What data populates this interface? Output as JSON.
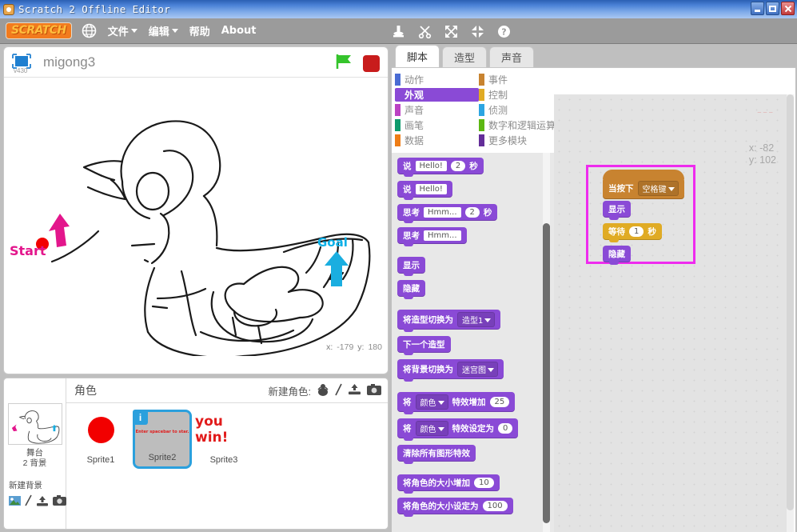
{
  "window": {
    "title": "Scratch 2 Offline Editor",
    "app_icon": "scratch-cat-icon",
    "buttons": {
      "minimize": "minimize-icon",
      "maximize": "maximize-icon",
      "close": "close-icon"
    }
  },
  "menubar": {
    "logo": "SCRATCH",
    "globe_icon": "globe-icon",
    "items": [
      {
        "label": "文件",
        "has_caret": true
      },
      {
        "label": "编辑",
        "has_caret": true
      },
      {
        "label": "帮助",
        "has_caret": false
      },
      {
        "label": "About",
        "has_caret": false
      }
    ],
    "tools": [
      {
        "name": "duplicate-icon"
      },
      {
        "name": "scissors-icon"
      },
      {
        "name": "grow-icon"
      },
      {
        "name": "shrink-icon"
      },
      {
        "name": "help-icon"
      }
    ]
  },
  "stage": {
    "version_tag": "v430",
    "project_name": "migong3",
    "presentation_icon": "presentation-mode-icon",
    "green_flag": "green-flag-icon",
    "stop_button": "stop-icon",
    "labels": {
      "start": "Start",
      "goal": "Goal"
    },
    "mouse_coords": {
      "x_label": "x:",
      "x": "-179",
      "y_label": "y:",
      "y": "180"
    }
  },
  "sprite_pane": {
    "stage_section": {
      "thumb_name": "stage-thumbnail",
      "title": "舞台",
      "subtitle": "2 背景",
      "new_backdrop_label": "新建背景",
      "new_backdrop_icons": [
        "library-icon",
        "paint-icon",
        "upload-icon",
        "camera-icon"
      ]
    },
    "header_title": "角色",
    "new_sprite_label": "新建角色:",
    "new_sprite_icons": [
      "library-icon",
      "paint-icon",
      "upload-icon",
      "camera-icon"
    ],
    "sprites": [
      {
        "name": "Sprite1",
        "selected": false,
        "kind": "red-dot"
      },
      {
        "name": "Sprite2",
        "selected": true,
        "kind": "text",
        "thumb_text": "Enter spacebar to star."
      },
      {
        "name": "Sprite3",
        "selected": false,
        "kind": "youwin",
        "thumb_text": "you win!"
      }
    ]
  },
  "editor": {
    "tabs": [
      {
        "label": "脚本",
        "active": true
      },
      {
        "label": "造型",
        "active": false
      },
      {
        "label": "声音",
        "active": false
      }
    ],
    "categories_left": [
      {
        "label": "动作",
        "color": "#4a6cd4",
        "active": false
      },
      {
        "label": "外观",
        "color": "#8a4ad6",
        "active": true
      },
      {
        "label": "声音",
        "color": "#bb42c3",
        "active": false
      },
      {
        "label": "画笔",
        "color": "#0e9a6c",
        "active": false
      },
      {
        "label": "数据",
        "color": "#ee7d16",
        "active": false
      }
    ],
    "categories_right": [
      {
        "label": "事件",
        "color": "#c88330",
        "active": false
      },
      {
        "label": "控制",
        "color": "#e0ab24",
        "active": false
      },
      {
        "label": "侦测",
        "color": "#2ca5e2",
        "active": false
      },
      {
        "label": "数字和逻辑运算",
        "color": "#5cb712",
        "active": false
      },
      {
        "label": "更多模块",
        "color": "#632d99",
        "active": false
      }
    ],
    "palette_blocks": [
      {
        "id": "say-for-secs",
        "parts": [
          {
            "t": "label",
            "v": "说"
          },
          {
            "t": "text",
            "v": "Hello!"
          },
          {
            "t": "num",
            "v": "2"
          },
          {
            "t": "label",
            "v": "秒"
          }
        ]
      },
      {
        "id": "say",
        "parts": [
          {
            "t": "label",
            "v": "说"
          },
          {
            "t": "text",
            "v": "Hello!"
          }
        ]
      },
      {
        "id": "think-for-secs",
        "parts": [
          {
            "t": "label",
            "v": "思考"
          },
          {
            "t": "text",
            "v": "Hmm..."
          },
          {
            "t": "num",
            "v": "2"
          },
          {
            "t": "label",
            "v": "秒"
          }
        ]
      },
      {
        "id": "think",
        "parts": [
          {
            "t": "label",
            "v": "思考"
          },
          {
            "t": "text",
            "v": "Hmm..."
          }
        ]
      },
      {
        "id": "spacer1",
        "spacer": true
      },
      {
        "id": "show",
        "parts": [
          {
            "t": "label",
            "v": "显示"
          }
        ]
      },
      {
        "id": "hide",
        "parts": [
          {
            "t": "label",
            "v": "隐藏"
          }
        ]
      },
      {
        "id": "spacer2",
        "spacer": true
      },
      {
        "id": "switch-costume",
        "parts": [
          {
            "t": "label",
            "v": "将造型切换为"
          },
          {
            "t": "drop",
            "v": "造型1"
          }
        ]
      },
      {
        "id": "next-costume",
        "parts": [
          {
            "t": "label",
            "v": "下一个造型"
          }
        ]
      },
      {
        "id": "switch-backdrop",
        "parts": [
          {
            "t": "label",
            "v": "将背景切换为"
          },
          {
            "t": "drop",
            "v": "迷宫图"
          }
        ]
      },
      {
        "id": "spacer3",
        "spacer": true
      },
      {
        "id": "change-effect",
        "parts": [
          {
            "t": "label",
            "v": "将"
          },
          {
            "t": "drop",
            "v": "颜色"
          },
          {
            "t": "label",
            "v": "特效增加"
          },
          {
            "t": "num",
            "v": "25"
          }
        ]
      },
      {
        "id": "set-effect",
        "parts": [
          {
            "t": "label",
            "v": "将"
          },
          {
            "t": "drop",
            "v": "颜色"
          },
          {
            "t": "label",
            "v": "特效设定为"
          },
          {
            "t": "num",
            "v": "0"
          }
        ]
      },
      {
        "id": "clear-effects",
        "parts": [
          {
            "t": "label",
            "v": "清除所有图形特效"
          }
        ]
      },
      {
        "id": "spacer4",
        "spacer": true
      },
      {
        "id": "change-size",
        "parts": [
          {
            "t": "label",
            "v": "将角色的大小增加"
          },
          {
            "t": "num",
            "v": "10"
          }
        ]
      },
      {
        "id": "set-size",
        "parts": [
          {
            "t": "label",
            "v": "将角色的大小设定为"
          },
          {
            "t": "num",
            "v": "100"
          }
        ]
      }
    ],
    "scripts": {
      "watermark": "— — —",
      "coords": {
        "x_label": "x:",
        "x": "-82",
        "y_label": "y:",
        "y": "102"
      },
      "stack": [
        {
          "kind": "hat",
          "category": "events",
          "label": "当按下",
          "dropdown": "空格键"
        },
        {
          "kind": "stack",
          "category": "looks",
          "label": "显示"
        },
        {
          "kind": "stack",
          "category": "control",
          "label": "等待",
          "num": "1",
          "suffix": "秒"
        },
        {
          "kind": "stack",
          "category": "looks",
          "label": "隐藏"
        }
      ],
      "annotation_arrow": "pink-left-arrow"
    }
  },
  "colors": {
    "accent_purple": "#8a4ad6",
    "events_orange": "#c88330",
    "control_yellow": "#e0ab24",
    "highlight_magenta": "#ee2bee",
    "start_pink": "#e3168c",
    "goal_cyan": "#0db1e8",
    "select_blue": "#2ba0dd",
    "red": "#e11b1b"
  }
}
